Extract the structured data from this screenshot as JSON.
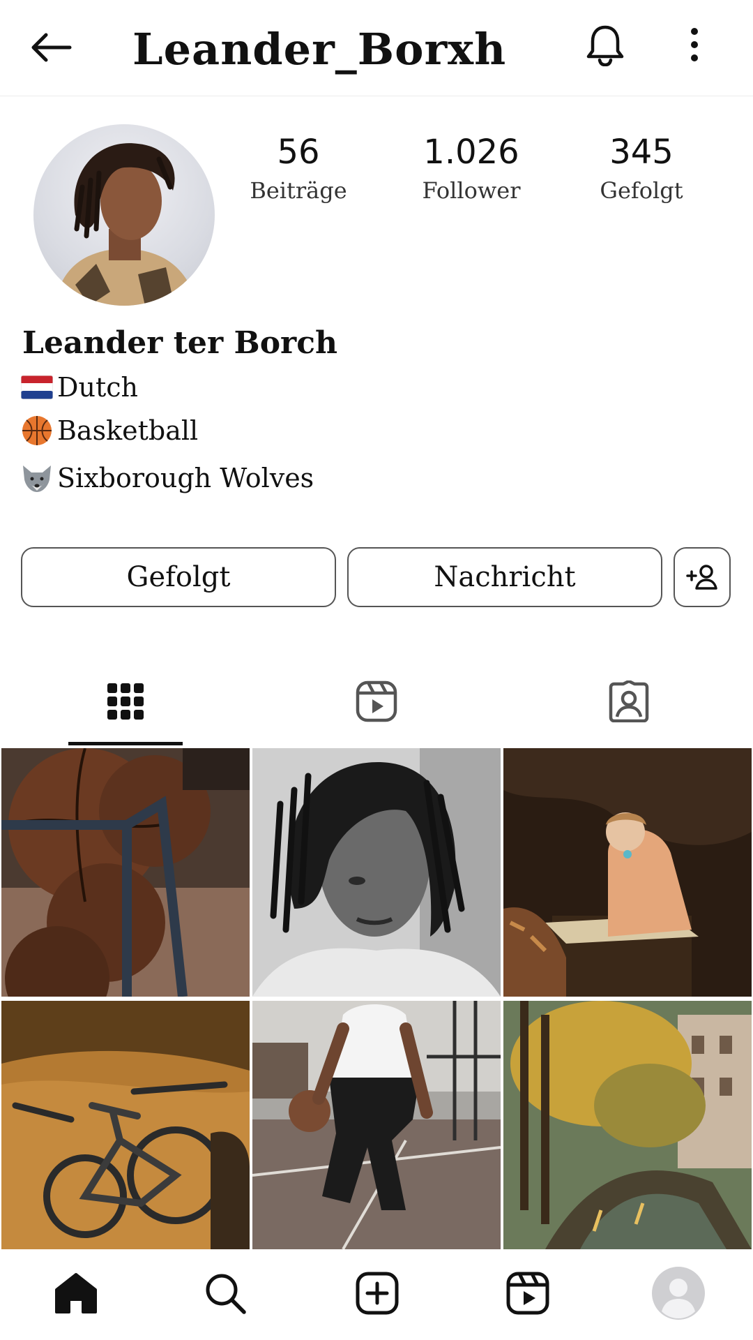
{
  "header": {
    "username": "Leander_Borxh"
  },
  "profile": {
    "stats": [
      {
        "value": "56",
        "label": "Beiträge"
      },
      {
        "value": "1.026",
        "label": "Follower"
      },
      {
        "value": "345",
        "label": "Gefolgt"
      }
    ],
    "full_name": "Leander ter Borch",
    "bio": [
      {
        "icon": "netherlands-flag-icon",
        "text": "Dutch"
      },
      {
        "icon": "basketball-icon",
        "text": "Basketball"
      },
      {
        "icon": "wolf-icon",
        "text": "Sixborough Wolves"
      }
    ]
  },
  "actions": {
    "follow_label": "Gefolgt",
    "message_label": "Nachricht"
  },
  "tabs": [
    {
      "icon": "grid-icon",
      "active": true
    },
    {
      "icon": "reels-icon",
      "active": false
    },
    {
      "icon": "tagged-icon",
      "active": false
    }
  ],
  "posts": [
    {
      "subject": "basketballs"
    },
    {
      "subject": "portrait-bw"
    },
    {
      "subject": "painting-woman-writing"
    },
    {
      "subject": "bicycle-night"
    },
    {
      "subject": "basketball-player"
    },
    {
      "subject": "canal-autumn"
    }
  ],
  "bottom_nav": [
    "home-icon",
    "search-icon",
    "add-post-icon",
    "reels-icon",
    "profile-avatar-icon"
  ],
  "colors": {
    "text": "#111111",
    "border": "#555555",
    "divider": "#ececec"
  }
}
